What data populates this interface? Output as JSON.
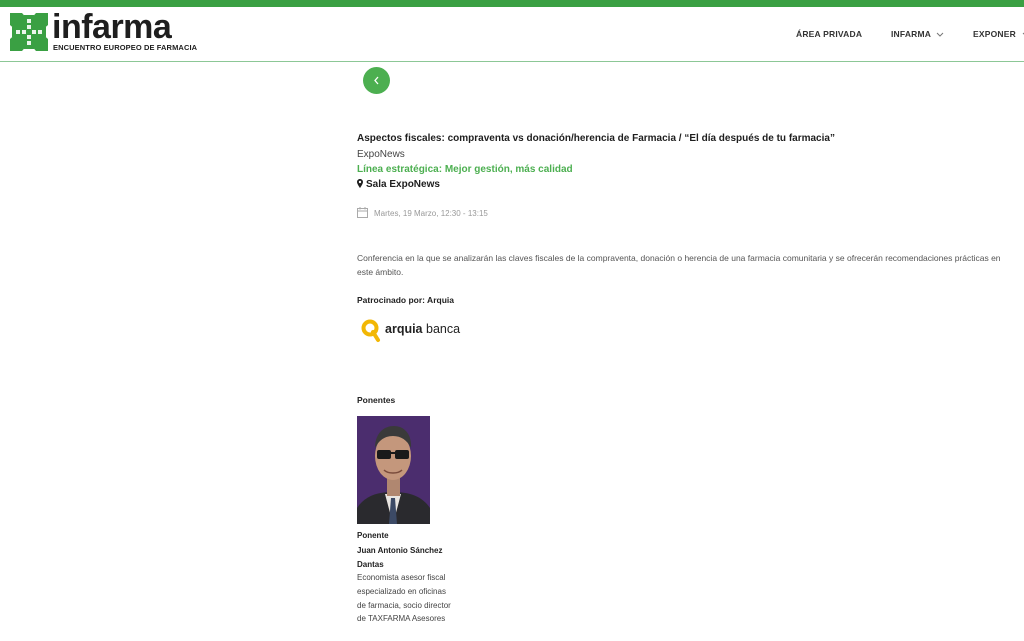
{
  "header": {
    "brand_name": "infarma",
    "brand_tagline": "ENCUENTRO EUROPEO DE FARMACIA",
    "nav": [
      {
        "label": "ÁREA PRIVADA"
      },
      {
        "label": "INFARMA"
      },
      {
        "label": "EXPONER"
      }
    ]
  },
  "event": {
    "title": "Aspectos fiscales: compraventa vs donación/herencia de Farmacia / “El día después de tu farmacia”",
    "category": "ExpoNews",
    "strategic_line": "Línea estratégica: Mejor gestión, más calidad",
    "room": "Sala ExpoNews",
    "datetime": "Martes, 19 Marzo, 12:30 - 13:15",
    "description": "Conferencia en la que se analizarán las claves fiscales de la compraventa, donación o herencia de una farmacia comunitaria y se ofrecerán recomendaciones prácticas en este ámbito.",
    "sponsor_label": "Patrocinado por: Arquia",
    "sponsor_logo_text": "arquia",
    "sponsor_logo_text2": "banca"
  },
  "speakers": {
    "heading": "Ponentes",
    "items": [
      {
        "role": "Ponente",
        "name": "Juan Antonio Sánchez Dantas",
        "bio": "Economista asesor fiscal especializado en oficinas de farmacia, socio director de TAXFARMA Asesores"
      }
    ]
  },
  "colors": {
    "brand_green": "#3aa043",
    "accent_green": "#4caf50",
    "sponsor_yellow": "#f2b705"
  }
}
